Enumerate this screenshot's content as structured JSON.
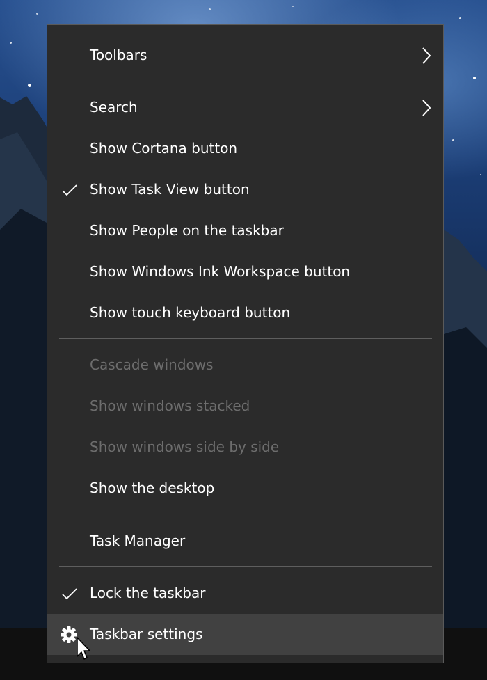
{
  "context_menu": {
    "items": [
      {
        "label": "Toolbars",
        "submenu": true
      },
      {
        "label": "Search",
        "submenu": true
      },
      {
        "label": "Show Cortana button"
      },
      {
        "label": "Show Task View button",
        "checked": true
      },
      {
        "label": "Show People on the taskbar"
      },
      {
        "label": "Show Windows Ink Workspace button"
      },
      {
        "label": "Show touch keyboard button"
      },
      {
        "label": "Cascade windows",
        "disabled": true
      },
      {
        "label": "Show windows stacked",
        "disabled": true
      },
      {
        "label": "Show windows side by side",
        "disabled": true
      },
      {
        "label": "Show the desktop"
      },
      {
        "label": "Task Manager"
      },
      {
        "label": "Lock the taskbar",
        "checked": true
      },
      {
        "label": "Taskbar settings",
        "icon": "gear-icon",
        "hovered": true
      }
    ]
  },
  "colors": {
    "menu_background": "#2b2b2b",
    "hover_background": "#414141",
    "text": "#ffffff",
    "disabled_text": "#6d6d6d",
    "separator": "#5e5e5e"
  }
}
